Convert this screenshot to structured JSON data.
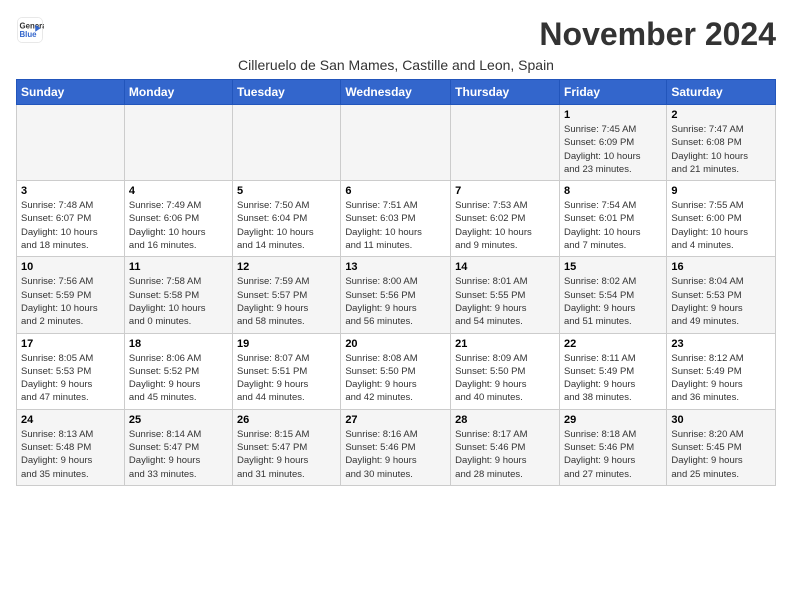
{
  "logo": {
    "line1": "General",
    "line2": "Blue"
  },
  "title": "November 2024",
  "subtitle": "Cilleruelo de San Mames, Castille and Leon, Spain",
  "headers": [
    "Sunday",
    "Monday",
    "Tuesday",
    "Wednesday",
    "Thursday",
    "Friday",
    "Saturday"
  ],
  "weeks": [
    [
      {
        "day": "",
        "info": ""
      },
      {
        "day": "",
        "info": ""
      },
      {
        "day": "",
        "info": ""
      },
      {
        "day": "",
        "info": ""
      },
      {
        "day": "",
        "info": ""
      },
      {
        "day": "1",
        "info": "Sunrise: 7:45 AM\nSunset: 6:09 PM\nDaylight: 10 hours\nand 23 minutes."
      },
      {
        "day": "2",
        "info": "Sunrise: 7:47 AM\nSunset: 6:08 PM\nDaylight: 10 hours\nand 21 minutes."
      }
    ],
    [
      {
        "day": "3",
        "info": "Sunrise: 7:48 AM\nSunset: 6:07 PM\nDaylight: 10 hours\nand 18 minutes."
      },
      {
        "day": "4",
        "info": "Sunrise: 7:49 AM\nSunset: 6:06 PM\nDaylight: 10 hours\nand 16 minutes."
      },
      {
        "day": "5",
        "info": "Sunrise: 7:50 AM\nSunset: 6:04 PM\nDaylight: 10 hours\nand 14 minutes."
      },
      {
        "day": "6",
        "info": "Sunrise: 7:51 AM\nSunset: 6:03 PM\nDaylight: 10 hours\nand 11 minutes."
      },
      {
        "day": "7",
        "info": "Sunrise: 7:53 AM\nSunset: 6:02 PM\nDaylight: 10 hours\nand 9 minutes."
      },
      {
        "day": "8",
        "info": "Sunrise: 7:54 AM\nSunset: 6:01 PM\nDaylight: 10 hours\nand 7 minutes."
      },
      {
        "day": "9",
        "info": "Sunrise: 7:55 AM\nSunset: 6:00 PM\nDaylight: 10 hours\nand 4 minutes."
      }
    ],
    [
      {
        "day": "10",
        "info": "Sunrise: 7:56 AM\nSunset: 5:59 PM\nDaylight: 10 hours\nand 2 minutes."
      },
      {
        "day": "11",
        "info": "Sunrise: 7:58 AM\nSunset: 5:58 PM\nDaylight: 10 hours\nand 0 minutes."
      },
      {
        "day": "12",
        "info": "Sunrise: 7:59 AM\nSunset: 5:57 PM\nDaylight: 9 hours\nand 58 minutes."
      },
      {
        "day": "13",
        "info": "Sunrise: 8:00 AM\nSunset: 5:56 PM\nDaylight: 9 hours\nand 56 minutes."
      },
      {
        "day": "14",
        "info": "Sunrise: 8:01 AM\nSunset: 5:55 PM\nDaylight: 9 hours\nand 54 minutes."
      },
      {
        "day": "15",
        "info": "Sunrise: 8:02 AM\nSunset: 5:54 PM\nDaylight: 9 hours\nand 51 minutes."
      },
      {
        "day": "16",
        "info": "Sunrise: 8:04 AM\nSunset: 5:53 PM\nDaylight: 9 hours\nand 49 minutes."
      }
    ],
    [
      {
        "day": "17",
        "info": "Sunrise: 8:05 AM\nSunset: 5:53 PM\nDaylight: 9 hours\nand 47 minutes."
      },
      {
        "day": "18",
        "info": "Sunrise: 8:06 AM\nSunset: 5:52 PM\nDaylight: 9 hours\nand 45 minutes."
      },
      {
        "day": "19",
        "info": "Sunrise: 8:07 AM\nSunset: 5:51 PM\nDaylight: 9 hours\nand 44 minutes."
      },
      {
        "day": "20",
        "info": "Sunrise: 8:08 AM\nSunset: 5:50 PM\nDaylight: 9 hours\nand 42 minutes."
      },
      {
        "day": "21",
        "info": "Sunrise: 8:09 AM\nSunset: 5:50 PM\nDaylight: 9 hours\nand 40 minutes."
      },
      {
        "day": "22",
        "info": "Sunrise: 8:11 AM\nSunset: 5:49 PM\nDaylight: 9 hours\nand 38 minutes."
      },
      {
        "day": "23",
        "info": "Sunrise: 8:12 AM\nSunset: 5:49 PM\nDaylight: 9 hours\nand 36 minutes."
      }
    ],
    [
      {
        "day": "24",
        "info": "Sunrise: 8:13 AM\nSunset: 5:48 PM\nDaylight: 9 hours\nand 35 minutes."
      },
      {
        "day": "25",
        "info": "Sunrise: 8:14 AM\nSunset: 5:47 PM\nDaylight: 9 hours\nand 33 minutes."
      },
      {
        "day": "26",
        "info": "Sunrise: 8:15 AM\nSunset: 5:47 PM\nDaylight: 9 hours\nand 31 minutes."
      },
      {
        "day": "27",
        "info": "Sunrise: 8:16 AM\nSunset: 5:46 PM\nDaylight: 9 hours\nand 30 minutes."
      },
      {
        "day": "28",
        "info": "Sunrise: 8:17 AM\nSunset: 5:46 PM\nDaylight: 9 hours\nand 28 minutes."
      },
      {
        "day": "29",
        "info": "Sunrise: 8:18 AM\nSunset: 5:46 PM\nDaylight: 9 hours\nand 27 minutes."
      },
      {
        "day": "30",
        "info": "Sunrise: 8:20 AM\nSunset: 5:45 PM\nDaylight: 9 hours\nand 25 minutes."
      }
    ]
  ]
}
